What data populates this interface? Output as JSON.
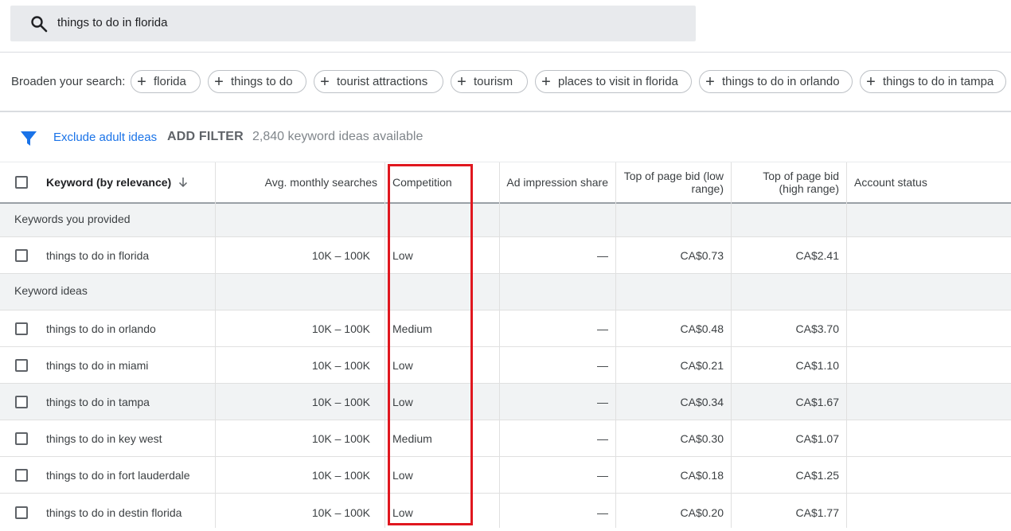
{
  "search": {
    "query": "things to do in florida"
  },
  "broaden": {
    "label": "Broaden your search:",
    "chips": [
      "florida",
      "things to do",
      "tourist attractions",
      "tourism",
      "places to visit in florida",
      "things to do in orlando",
      "things to do in tampa"
    ]
  },
  "filters": {
    "exclude_adult": "Exclude adult ideas",
    "add_filter": "ADD FILTER",
    "available": "2,840 keyword ideas available"
  },
  "table": {
    "headers": {
      "keyword": "Keyword (by relevance)",
      "searches": "Avg. monthly searches",
      "competition": "Competition",
      "impression_share": "Ad impression share",
      "bid_low_1": "Top of page bid (low",
      "bid_low_2": "range)",
      "bid_high_1": "Top of page bid",
      "bid_high_2": "(high range)",
      "status": "Account status"
    },
    "groups": {
      "provided": "Keywords you provided",
      "ideas": "Keyword ideas"
    },
    "provided_rows": [
      {
        "keyword": "things to do in florida",
        "searches": "10K – 100K",
        "competition": "Low",
        "impression": "—",
        "bid_low": "CA$0.73",
        "bid_high": "CA$2.41"
      }
    ],
    "idea_rows": [
      {
        "keyword": "things to do in orlando",
        "searches": "10K – 100K",
        "competition": "Medium",
        "impression": "—",
        "bid_low": "CA$0.48",
        "bid_high": "CA$3.70"
      },
      {
        "keyword": "things to do in miami",
        "searches": "10K – 100K",
        "competition": "Low",
        "impression": "—",
        "bid_low": "CA$0.21",
        "bid_high": "CA$1.10"
      },
      {
        "keyword": "things to do in tampa",
        "searches": "10K – 100K",
        "competition": "Low",
        "impression": "—",
        "bid_low": "CA$0.34",
        "bid_high": "CA$1.67"
      },
      {
        "keyword": "things to do in key west",
        "searches": "10K – 100K",
        "competition": "Medium",
        "impression": "—",
        "bid_low": "CA$0.30",
        "bid_high": "CA$1.07"
      },
      {
        "keyword": "things to do in fort lauderdale",
        "searches": "10K – 100K",
        "competition": "Low",
        "impression": "—",
        "bid_low": "CA$0.18",
        "bid_high": "CA$1.25"
      },
      {
        "keyword": "things to do in destin florida",
        "searches": "10K – 100K",
        "competition": "Low",
        "impression": "—",
        "bid_low": "CA$0.20",
        "bid_high": "CA$1.77"
      }
    ]
  },
  "colors": {
    "highlight_box": "#e0171f",
    "accent_blue": "#1a73e8",
    "search_bg": "#e8eaed"
  },
  "icons": {
    "search": "search-icon",
    "filter": "filter-icon",
    "sort": "arrow-down-icon",
    "chip_add": "plus-icon"
  }
}
